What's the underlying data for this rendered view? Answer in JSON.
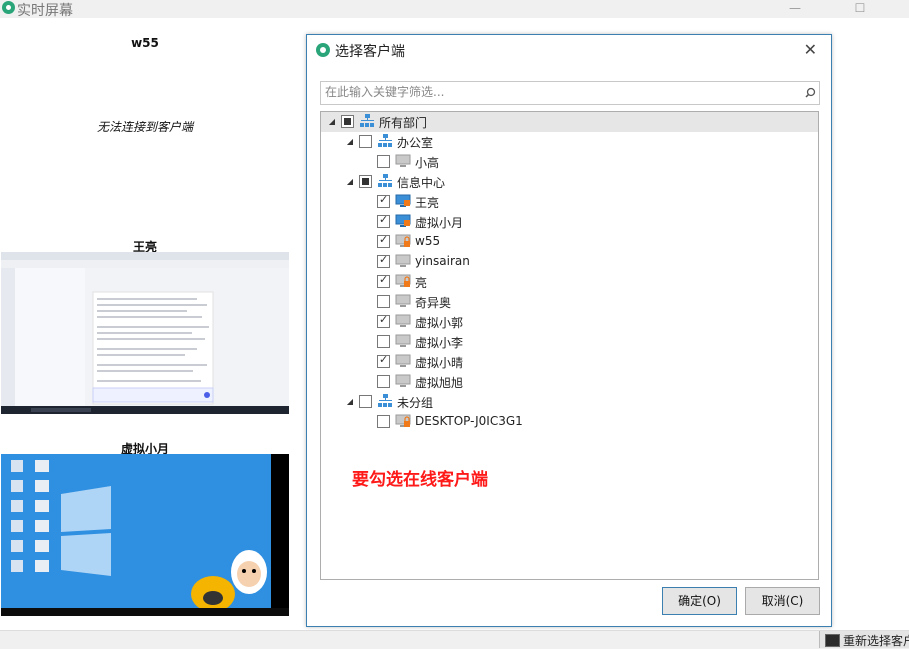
{
  "app": {
    "title": "实时屏幕"
  },
  "clients": [
    {
      "name": "w55",
      "status_text": "无法连接到客户端"
    },
    {
      "name": "王亮"
    },
    {
      "name": "虚拟小月"
    }
  ],
  "dialog": {
    "title": "选择客户端",
    "search_placeholder": "在此输入关键字筛选...",
    "tree": {
      "root": {
        "label": "所有部门",
        "state": "partial",
        "expanded": true
      },
      "groups": [
        {
          "label": "办公室",
          "state": "unchecked",
          "expanded": true,
          "clients": [
            {
              "label": "小高",
              "checked": false,
              "online": false
            }
          ]
        },
        {
          "label": "信息中心",
          "state": "partial",
          "expanded": true,
          "clients": [
            {
              "label": "王亮",
              "checked": true,
              "online": true
            },
            {
              "label": "虚拟小月",
              "checked": true,
              "online": true
            },
            {
              "label": "w55",
              "checked": true,
              "online": false
            },
            {
              "label": "yinsairan",
              "checked": true,
              "online": false
            },
            {
              "label": "亮",
              "checked": true,
              "online": false
            },
            {
              "label": "奇异奥",
              "checked": false,
              "online": false
            },
            {
              "label": "虚拟小郭",
              "checked": true,
              "online": false
            },
            {
              "label": "虚拟小李",
              "checked": false,
              "online": false
            },
            {
              "label": "虚拟小晴",
              "checked": true,
              "online": false
            },
            {
              "label": "虚拟旭旭",
              "checked": false,
              "online": false
            }
          ]
        },
        {
          "label": "未分组",
          "state": "unchecked",
          "expanded": true,
          "clients": [
            {
              "label": "DESKTOP-J0IC3G1",
              "checked": false,
              "online": false
            }
          ]
        }
      ]
    },
    "hint_text": "要勾选在线客户端",
    "ok_label": "确定(O)",
    "cancel_label": "取消(C)"
  },
  "statusbar": {
    "reselect_label": "重新选择客户"
  },
  "colors": {
    "accent": "#3c7fb1",
    "hint": "#ff1a1a",
    "online": "#3b8fd6",
    "lock": "#f07a1a"
  }
}
